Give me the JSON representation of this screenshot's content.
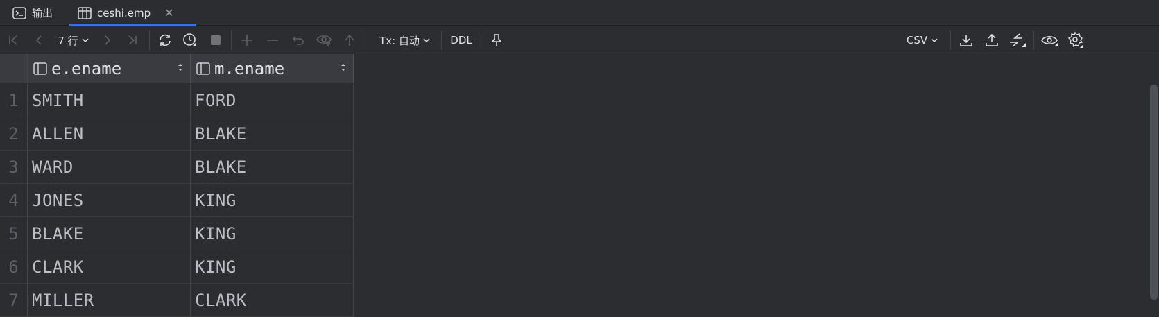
{
  "tabs": [
    {
      "label": "输出",
      "icon": "terminal-icon"
    },
    {
      "label": "ceshi.emp",
      "icon": "table-icon",
      "active": true
    }
  ],
  "toolbar": {
    "row_count": "7 行",
    "tx_mode": "Tx: 自动",
    "ddl": "DDL",
    "export_format": "CSV"
  },
  "table": {
    "columns": [
      "e.ename",
      "m.ename"
    ],
    "rows": [
      {
        "n": "1",
        "e": "SMITH",
        "m": "FORD"
      },
      {
        "n": "2",
        "e": "ALLEN",
        "m": "BLAKE"
      },
      {
        "n": "3",
        "e": "WARD",
        "m": "BLAKE"
      },
      {
        "n": "4",
        "e": "JONES",
        "m": "KING"
      },
      {
        "n": "5",
        "e": "BLAKE",
        "m": "KING"
      },
      {
        "n": "6",
        "e": "CLARK",
        "m": "KING"
      },
      {
        "n": "7",
        "e": "MILLER",
        "m": "CLARK"
      }
    ]
  },
  "colors": {
    "background": "#2b2d30",
    "accent": "#3574f0",
    "header": "#393b40"
  }
}
